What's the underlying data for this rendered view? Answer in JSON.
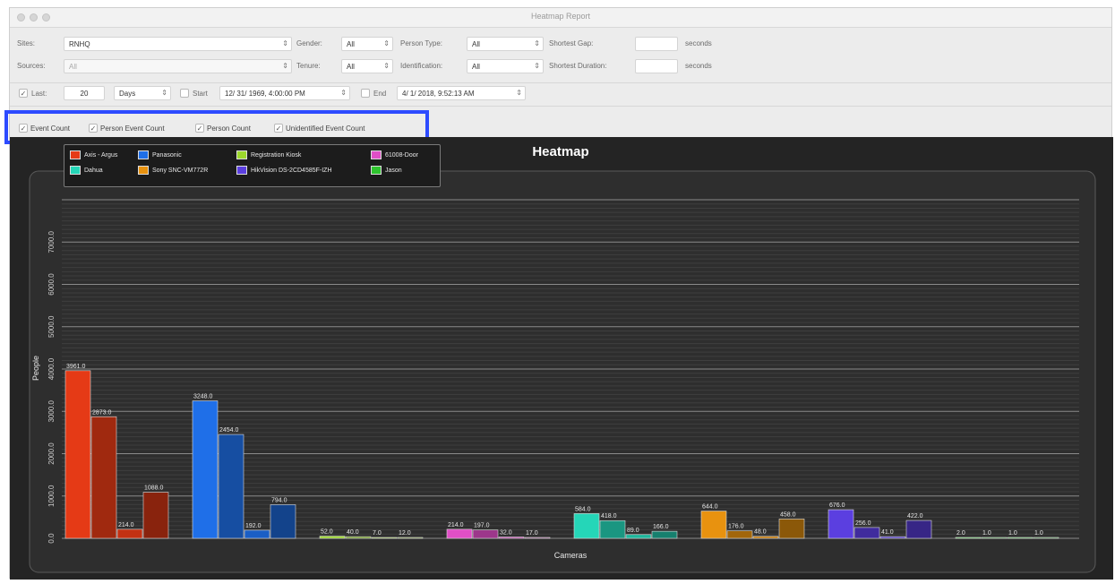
{
  "window": {
    "title": "Heatmap Report"
  },
  "filters": {
    "sites_label": "Sites:",
    "sites_value": "RNHQ",
    "sources_label": "Sources:",
    "sources_value": "All",
    "gender_label": "Gender:",
    "gender_value": "All",
    "tenure_label": "Tenure:",
    "tenure_value": "All",
    "person_type_label": "Person Type:",
    "person_type_value": "All",
    "identification_label": "Identification:",
    "identification_value": "All",
    "shortest_gap_label": "Shortest Gap:",
    "shortest_gap_unit": "seconds",
    "shortest_duration_label": "Shortest Duration:",
    "shortest_duration_unit": "seconds",
    "last_label": "Last:",
    "last_value": "20",
    "last_unit": "Days",
    "start_label": "Start",
    "start_value": "12/ 31/ 1969,  4:00:00 PM",
    "end_label": "End",
    "end_value": "4/  1/ 2018,  9:52:13 AM"
  },
  "counts": {
    "event_count": "Event Count",
    "person_event_count": "Person Event Count",
    "person_count": "Person Count",
    "unidentified_event_count": "Unidentified Event Count"
  },
  "chart_data": {
    "type": "bar",
    "title": "Heatmap",
    "xlabel": "Cameras",
    "ylabel": "People",
    "ylim": [
      0,
      8000
    ],
    "yticks": [
      "0.0",
      "1000.0",
      "2000.0",
      "3000.0",
      "4000.0",
      "5000.0",
      "6000.0",
      "7000.0"
    ],
    "grid": true,
    "legend_position": "top-left",
    "series": [
      {
        "name": "Axis - Argus",
        "color": "#e53a16",
        "values": [
          3961.0,
          2873.0,
          214.0,
          1088.0
        ],
        "labels": [
          "3961.0",
          "2873.0",
          "214.0",
          "1088.0"
        ]
      },
      {
        "name": "Panasonic",
        "color": "#1f6fe8",
        "values": [
          3248.0,
          2454.0,
          192.0,
          794.0
        ],
        "labels": [
          "3248.0",
          "2454.0",
          "192.0",
          "794.0"
        ]
      },
      {
        "name": "Registration Kiosk",
        "color": "#9cd72c",
        "values": [
          52.0,
          40.0,
          7.0,
          12.0
        ],
        "labels": [
          "52.0",
          "40.0",
          "7.0",
          "12.0"
        ]
      },
      {
        "name": "61008-Door",
        "color": "#e04fc6",
        "values": [
          214.0,
          197.0,
          32.0,
          17.0
        ],
        "labels": [
          "214.0",
          "197.0",
          "32.0",
          "17.0"
        ]
      },
      {
        "name": "Dahua",
        "color": "#25d6b8",
        "values": [
          584.0,
          418.0,
          89.0,
          166.0
        ],
        "labels": [
          "584.0",
          "418.0",
          "89.0",
          "166.0"
        ]
      },
      {
        "name": "Sony SNC-VM772R",
        "color": "#e8920f",
        "values": [
          644.0,
          176.0,
          48.0,
          458.0
        ],
        "labels": [
          "644.0",
          "176.0",
          "48.0",
          "458.0"
        ]
      },
      {
        "name": "HikVision DS-2CD4585F-IZH",
        "color": "#5b3fe0",
        "values": [
          676.0,
          256.0,
          41.0,
          422.0
        ],
        "labels": [
          "676.0",
          "256.0",
          "41.0",
          "422.0"
        ]
      },
      {
        "name": "Jason",
        "color": "#2fc42f",
        "values": [
          2.0,
          1.0,
          1.0,
          1.0
        ],
        "labels": [
          "2.0",
          "1.0",
          "1.0",
          "1.0"
        ]
      }
    ]
  }
}
